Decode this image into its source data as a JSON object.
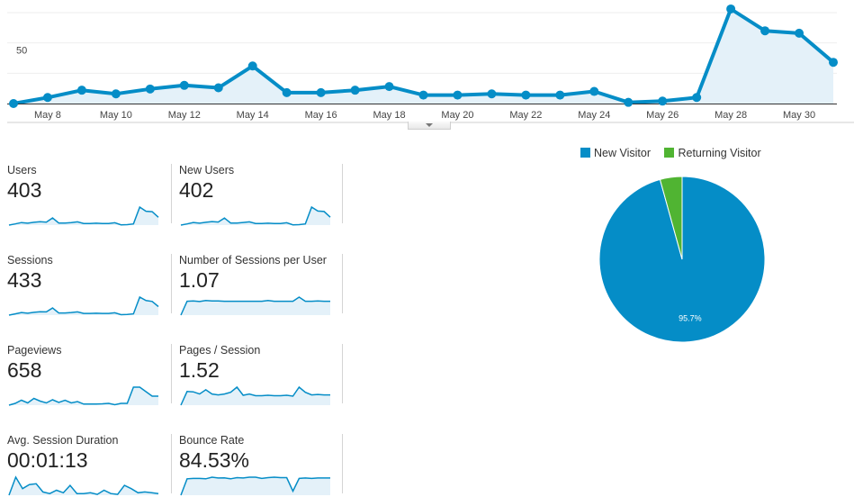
{
  "colors": {
    "primary": "#058dc7",
    "secondary": "#50b432",
    "area_fill": "#e4f1f9",
    "grid": "#eeeeee",
    "axis": "#333333"
  },
  "chart_data": [
    {
      "type": "line",
      "title": "",
      "xlabel": "",
      "ylabel": "",
      "series_name": "Users",
      "x": [
        "May 7",
        "May 8",
        "May 9",
        "May 10",
        "May 11",
        "May 12",
        "May 13",
        "May 14",
        "May 15",
        "May 16",
        "May 17",
        "May 18",
        "May 19",
        "May 20",
        "May 21",
        "May 22",
        "May 23",
        "May 24",
        "May 25",
        "May 26",
        "May 27",
        "May 28",
        "May 29",
        "May 30",
        "May 31"
      ],
      "values": [
        0,
        5,
        11,
        8,
        12,
        15,
        13,
        31,
        9,
        9,
        11,
        14,
        7,
        7,
        8,
        7,
        7,
        10,
        1,
        2,
        5,
        78,
        60,
        58,
        34
      ],
      "x_tick_labels": [
        "May 8",
        "May 10",
        "May 12",
        "May 14",
        "May 16",
        "May 18",
        "May 20",
        "May 22",
        "May 24",
        "May 26",
        "May 28",
        "May 30"
      ],
      "y_tick_labels": [
        "50"
      ],
      "y_ticks": [
        50
      ],
      "gridlines_y": [
        25,
        50,
        75
      ],
      "ylim": [
        0,
        75
      ],
      "grid": true,
      "area_fill": true
    },
    {
      "type": "pie",
      "title": "",
      "legend_position": "top",
      "slices": [
        {
          "label": "New Visitor",
          "value": 95.7,
          "color": "#058dc7",
          "data_label": "95.7%"
        },
        {
          "label": "Returning Visitor",
          "value": 4.3,
          "color": "#50b432",
          "data_label": ""
        }
      ]
    }
  ],
  "metrics": [
    {
      "label": "Users",
      "value": "403",
      "spark": [
        0,
        5,
        11,
        8,
        12,
        15,
        13,
        31,
        9,
        9,
        11,
        14,
        7,
        7,
        8,
        7,
        7,
        10,
        1,
        2,
        5,
        78,
        60,
        58,
        34
      ]
    },
    {
      "label": "New Users",
      "value": "402",
      "spark": [
        0,
        5,
        11,
        8,
        12,
        15,
        13,
        30,
        9,
        9,
        11,
        14,
        7,
        7,
        8,
        7,
        7,
        10,
        1,
        2,
        5,
        77,
        60,
        58,
        34
      ]
    },
    {
      "label": "Sessions",
      "value": "433",
      "spark": [
        0,
        6,
        12,
        9,
        13,
        16,
        15,
        33,
        10,
        10,
        12,
        15,
        8,
        8,
        9,
        8,
        8,
        11,
        2,
        3,
        6,
        84,
        68,
        64,
        40
      ]
    },
    {
      "label": "Number of Sessions per User",
      "value": "1.07",
      "spark": [
        0,
        1.0,
        1.02,
        0.98,
        1.06,
        1.03,
        1.03,
        1.0,
        1.0,
        1.0,
        1.0,
        1.0,
        1.0,
        1.0,
        1.05,
        1.0,
        1.0,
        1.0,
        1.0,
        1.3,
        1.0,
        1.0,
        1.03,
        1.0,
        1.0
      ]
    },
    {
      "label": "Pageviews",
      "value": "658",
      "spark": [
        0,
        8,
        22,
        10,
        30,
        18,
        10,
        24,
        12,
        22,
        10,
        16,
        5,
        5,
        5,
        6,
        8,
        2,
        8,
        8,
        80,
        80,
        60,
        40,
        40
      ]
    },
    {
      "label": "Pages / Session",
      "value": "1.52",
      "spark": [
        0,
        1.6,
        1.55,
        1.3,
        1.8,
        1.3,
        1.2,
        1.3,
        1.5,
        2.1,
        1.15,
        1.3,
        1.1,
        1.1,
        1.15,
        1.1,
        1.1,
        1.15,
        1.05,
        2.1,
        1.5,
        1.2,
        1.25,
        1.2,
        1.2
      ]
    },
    {
      "label": "Avg. Session Duration",
      "value": "00:01:13",
      "spark": [
        0,
        2.2,
        0.8,
        1.3,
        1.4,
        0.4,
        0.2,
        0.6,
        0.3,
        1.2,
        0.2,
        0.2,
        0.3,
        0.1,
        0.6,
        0.2,
        0.1,
        1.2,
        0.8,
        0.3,
        0.4,
        0.3,
        0.2
      ]
    },
    {
      "label": "Bounce Rate",
      "value": "84.53%",
      "spark": [
        0,
        80,
        82,
        82,
        80,
        88,
        84,
        85,
        80,
        86,
        84,
        88,
        88,
        82,
        86,
        88,
        86,
        86,
        20,
        82,
        84,
        82,
        84,
        84,
        84
      ]
    }
  ],
  "ui": {
    "collapse_handle": "chevron-down"
  }
}
